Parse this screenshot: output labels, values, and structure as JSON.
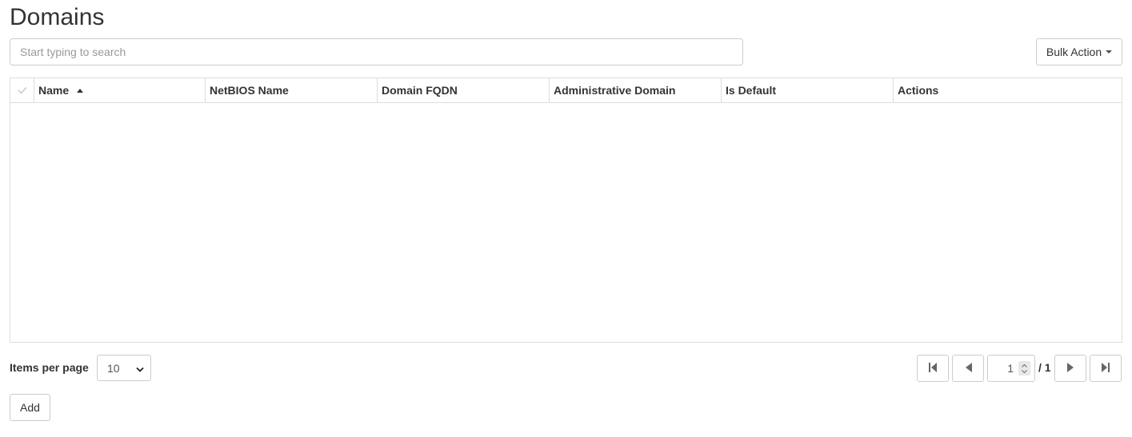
{
  "page": {
    "title": "Domains"
  },
  "search": {
    "placeholder": "Start typing to search"
  },
  "bulk_action": {
    "label": "Bulk Action"
  },
  "table": {
    "columns": [
      "Name",
      "NetBIOS Name",
      "Domain FQDN",
      "Administrative Domain",
      "Is Default",
      "Actions"
    ],
    "sorted_column": "Name",
    "sort_direction": "ascending",
    "rows": []
  },
  "pagination": {
    "items_per_page_label": "Items per page",
    "items_per_page_value": "10",
    "current_page": "1",
    "total_pages": "/ 1"
  },
  "actions": {
    "add_label": "Add"
  },
  "icons": [
    "check-icon",
    "sort-ascending-icon",
    "caret-down-icon",
    "chevron-down-icon",
    "first-page-icon",
    "previous-page-icon",
    "spinner-arrows-icon",
    "next-page-icon",
    "last-page-icon"
  ]
}
